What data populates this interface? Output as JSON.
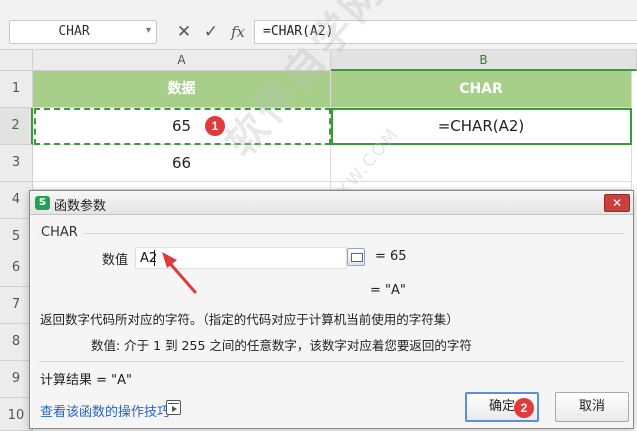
{
  "formula_bar": {
    "name_box": "CHAR",
    "cancel_icon": "✕",
    "confirm_icon": "✓",
    "fx_label": "fx",
    "formula": "=CHAR(A2)"
  },
  "grid": {
    "columns": [
      "A",
      "B"
    ],
    "rows": [
      "1",
      "2",
      "3",
      "4",
      "5",
      "6",
      "7",
      "8",
      "9",
      "10"
    ],
    "header_row": [
      "数据",
      "CHAR"
    ],
    "cells": {
      "a2": "65",
      "b2": "=CHAR(A2)",
      "a3": "66"
    }
  },
  "watermark": {
    "main": "软件自学网",
    "sub": "WWW.RJZXW.COM"
  },
  "badges": {
    "one": "1",
    "two": "2"
  },
  "dialog": {
    "title": "函数参数",
    "app_icon": "S",
    "close_icon": "✕",
    "function_name": "CHAR",
    "arg_label": "数值",
    "arg_value": "A2",
    "arg_result": "=  65",
    "function_result": "=  \"A\"",
    "description": "返回数字代码所对应的字符。（指定的代码对应于计算机当前使用的字符集）",
    "arg_description": "数值:  介于 1 到 255 之间的任意数字，该数字对应着您要返回的字符",
    "calc_result": "计算结果  =  \"A\"",
    "help_link": "查看该函数的操作技巧",
    "ok_label": "确定",
    "cancel_label": "取消"
  },
  "colors": {
    "header_green": "#a8cf8a",
    "selection_green": "#3a9a3a",
    "badge_red": "#e03a3a",
    "link_blue": "#2b63c6"
  }
}
